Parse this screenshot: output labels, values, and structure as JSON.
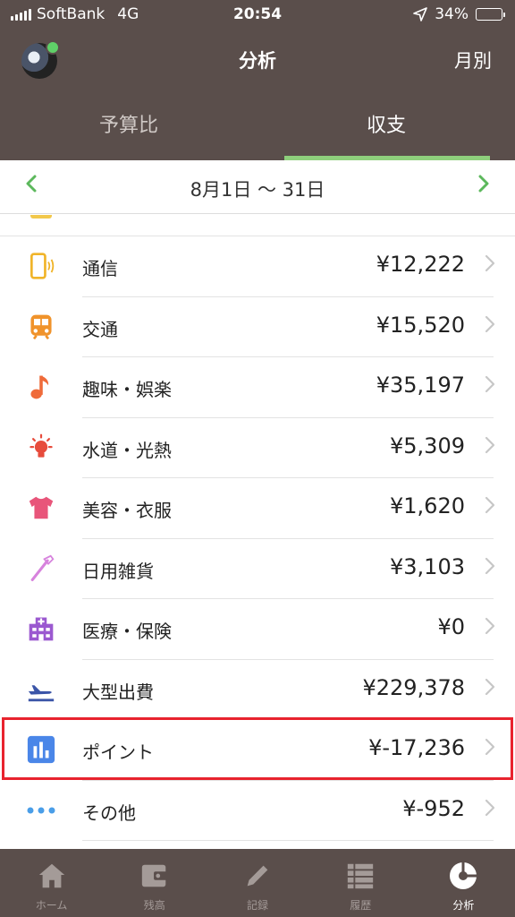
{
  "status": {
    "carrier": "SoftBank",
    "network": "4G",
    "time": "20:54",
    "battery": "34%",
    "battery_level": 0.34
  },
  "header": {
    "title": "分析",
    "period": "月別",
    "tabs": [
      {
        "label": "予算比",
        "active": false
      },
      {
        "label": "収支",
        "active": true
      }
    ]
  },
  "datebar": {
    "range": "8月1日 〜 31日"
  },
  "categories": [
    {
      "label": "通信",
      "amount": "¥12,222",
      "icon": "phone-icon",
      "color": "#f0b429"
    },
    {
      "label": "交通",
      "amount": "¥15,520",
      "icon": "train-icon",
      "color": "#f0932b"
    },
    {
      "label": "趣味・娯楽",
      "amount": "¥35,197",
      "icon": "music-note-icon",
      "color": "#ef6b3a"
    },
    {
      "label": "水道・光熱",
      "amount": "¥5,309",
      "icon": "lightbulb-icon",
      "color": "#e74c3c"
    },
    {
      "label": "美容・衣服",
      "amount": "¥1,620",
      "icon": "shirt-icon",
      "color": "#e8557a"
    },
    {
      "label": "日用雑貨",
      "amount": "¥3,103",
      "icon": "toothbrush-icon",
      "color": "#d783dd"
    },
    {
      "label": "医療・保険",
      "amount": "¥0",
      "icon": "hospital-icon",
      "color": "#9b59d0"
    },
    {
      "label": "大型出費",
      "amount": "¥229,378",
      "icon": "airplane-icon",
      "color": "#3b55a8"
    },
    {
      "label": "ポイント",
      "amount": "¥-17,236",
      "icon": "bar-chart-icon",
      "color": "#4a86e8"
    },
    {
      "label": "その他",
      "amount": "¥-952",
      "icon": "more-dots-icon",
      "color": "#4a9ee8"
    }
  ],
  "tabbar": [
    {
      "label": "ホーム",
      "icon": "home-icon",
      "active": false
    },
    {
      "label": "残高",
      "icon": "wallet-icon",
      "active": false
    },
    {
      "label": "記録",
      "icon": "pencil-icon",
      "active": false
    },
    {
      "label": "履歴",
      "icon": "list-icon",
      "active": false
    },
    {
      "label": "分析",
      "icon": "pie-chart-icon",
      "active": true
    }
  ]
}
